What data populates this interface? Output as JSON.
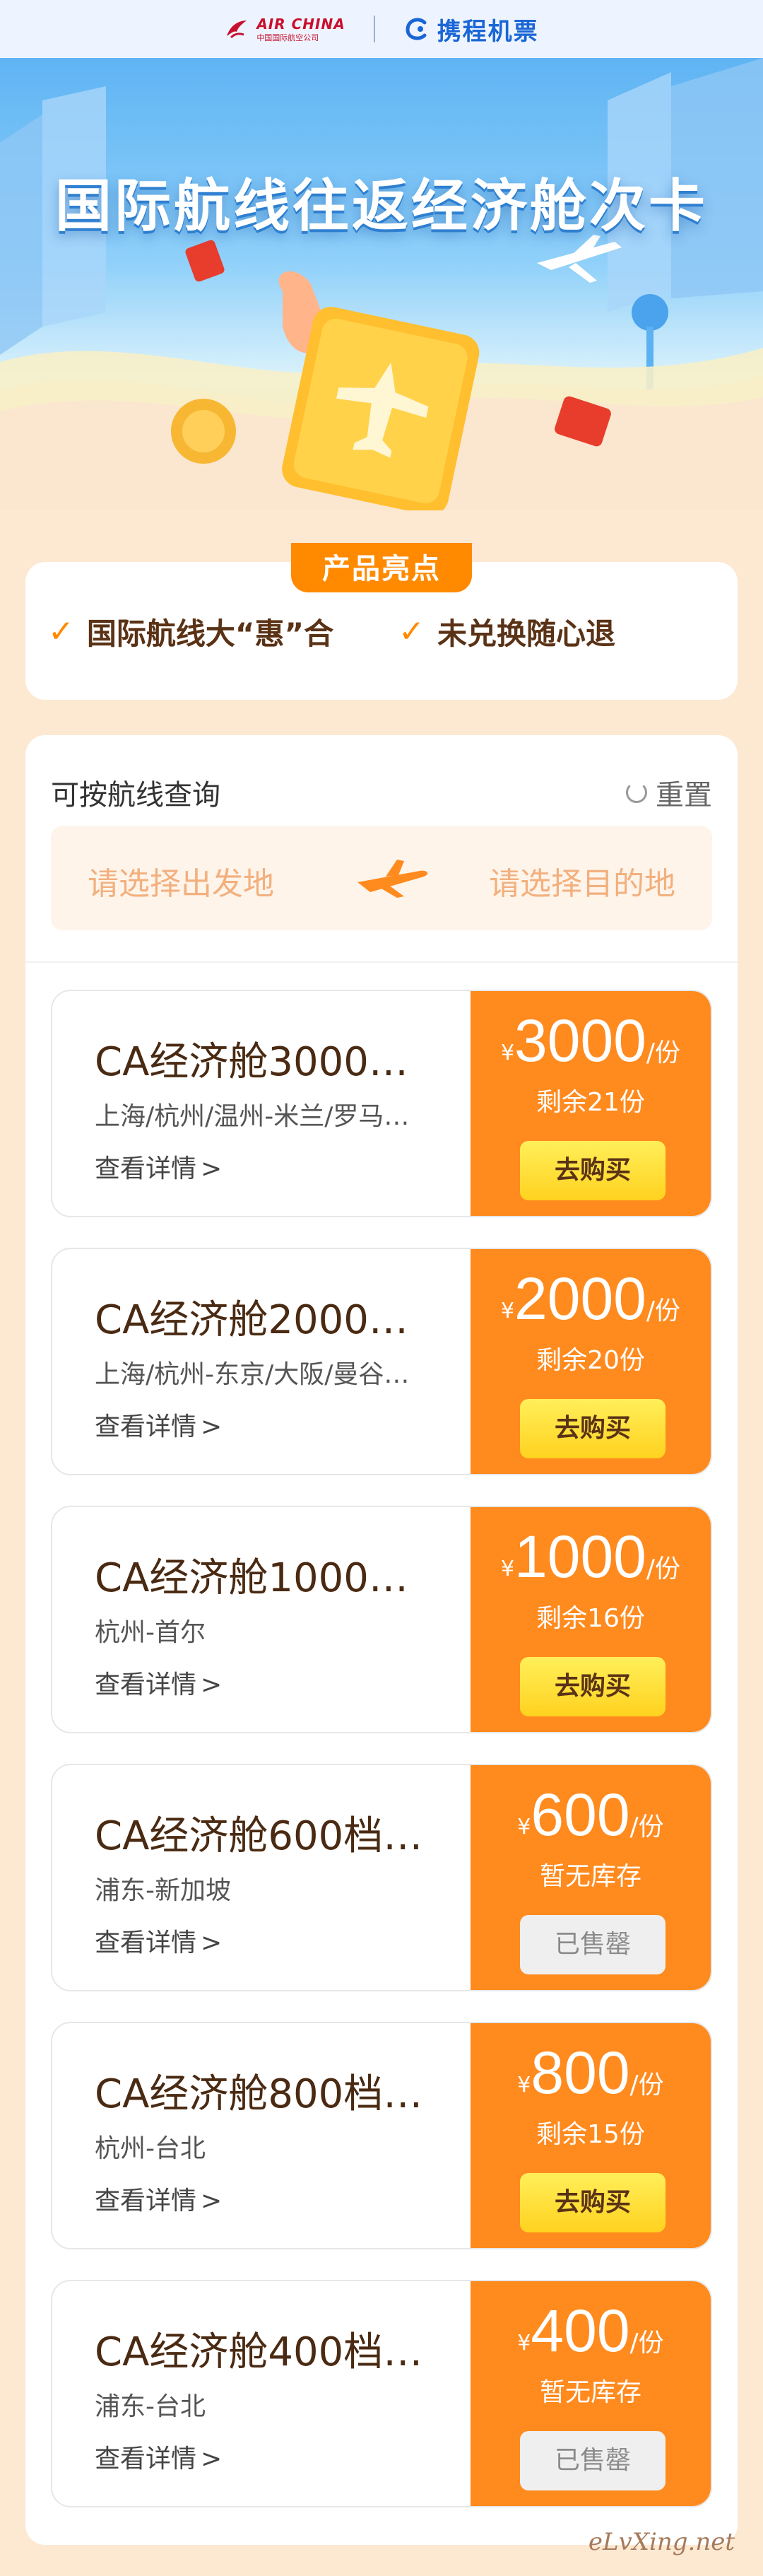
{
  "brands": {
    "airchina_en": "AIR CHINA",
    "airchina_cn": "中国国际航空公司",
    "ctrip": "携程机票"
  },
  "hero": {
    "title": "国际航线往返经济舱次卡"
  },
  "highlights": {
    "tag": "产品亮点",
    "items": [
      "国际航线大“惠”合",
      "未兑换随心退"
    ]
  },
  "query": {
    "title": "可按航线查询",
    "reset": "重置",
    "from_placeholder": "请选择出发地",
    "to_placeholder": "请选择目的地"
  },
  "products": [
    {
      "name": "CA经济舱3000…",
      "routes": "上海/杭州/温州-米兰/罗马…",
      "detail": "查看详情",
      "currency": "¥",
      "price": "3000",
      "unit": "/份",
      "stock": "剩余21份",
      "button": "去购买",
      "sold_out": false
    },
    {
      "name": "CA经济舱2000…",
      "routes": "上海/杭州-东京/大阪/曼谷…",
      "detail": "查看详情",
      "currency": "¥",
      "price": "2000",
      "unit": "/份",
      "stock": "剩余20份",
      "button": "去购买",
      "sold_out": false
    },
    {
      "name": "CA经济舱1000…",
      "routes": "杭州-首尔",
      "detail": "查看详情",
      "currency": "¥",
      "price": "1000",
      "unit": "/份",
      "stock": "剩余16份",
      "button": "去购买",
      "sold_out": false
    },
    {
      "name": "CA经济舱600档…",
      "routes": "浦东-新加坡",
      "detail": "查看详情",
      "currency": "¥",
      "price": "600",
      "unit": "/份",
      "stock": "暂无库存",
      "button": "已售罄",
      "sold_out": true
    },
    {
      "name": "CA经济舱800档…",
      "routes": "杭州-台北",
      "detail": "查看详情",
      "currency": "¥",
      "price": "800",
      "unit": "/份",
      "stock": "剩余15份",
      "button": "去购买",
      "sold_out": false
    },
    {
      "name": "CA经济舱400档…",
      "routes": "浦东-台北",
      "detail": "查看详情",
      "currency": "¥",
      "price": "400",
      "unit": "/份",
      "stock": "暂无库存",
      "button": "已售罄",
      "sold_out": true
    }
  ],
  "watermark": "eLvXing.net",
  "colors": {
    "accent": "#ff8a1e",
    "buy_button": "#ffd21f",
    "page_bg": "#fde8d2"
  }
}
